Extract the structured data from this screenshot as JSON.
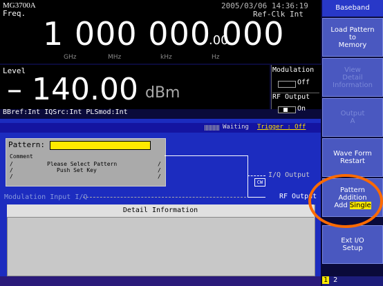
{
  "header": {
    "brand": "MG3700A",
    "datetime": "2005/03/06 14:36:19",
    "freq_label": "Freq.",
    "ref_clk": "Ref-Clk Int"
  },
  "frequency": {
    "value": "1 000 000 000",
    "fraction": ".00",
    "units": [
      "GHz",
      "MHz",
      "kHz",
      "Hz"
    ]
  },
  "level": {
    "label": "Level",
    "value": "– 140.00",
    "unit": "dBm",
    "status": "BBref:Int   IQSrc:Int   PLSmod:Int"
  },
  "modulation": {
    "label": "Modulation",
    "state": "Off"
  },
  "rf_output": {
    "label": "RF Output",
    "state": "On"
  },
  "statusbar": {
    "waiting": "Waiting",
    "trigger": "Trigger : Off"
  },
  "pattern": {
    "label": "Pattern:",
    "comment_label": "Comment",
    "line1": "Please Select Pattern",
    "line2": "Push Set Key"
  },
  "diagram": {
    "iq_output": "I/Q Output",
    "cw": "CW",
    "rf_output": "RF Output",
    "mod_input": "Modulation Input I/Q"
  },
  "detail": {
    "title": "Detail Information"
  },
  "softkeys": {
    "header": "Baseband",
    "k1": "Load Pattern\nto\nMemory",
    "k2": "View\nDetail\nInformation",
    "k3": "Output\nA",
    "k4": "Wave Form\nRestart",
    "k5_top": "Pattern\nAddition",
    "k5_add": "Add",
    "k5_single": "Single",
    "k6": "Ext I/O\nSetup",
    "page1": "1",
    "page2": "2"
  },
  "colors": {
    "accent": "#ffea00",
    "panel": "#1c2cbf",
    "highlight_circle": "#ff6a00"
  }
}
